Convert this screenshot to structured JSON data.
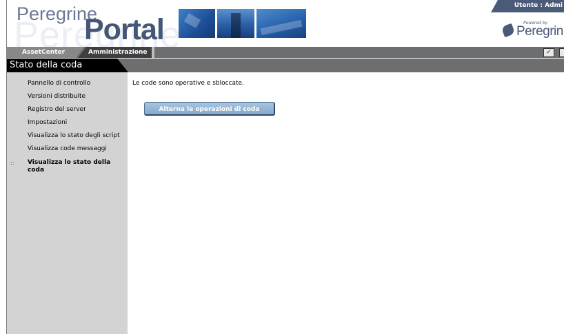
{
  "header": {
    "brand_small": "Peregrine",
    "brand_big": "Portal",
    "brand_ghost": "Peregrine",
    "user_label": "Utente : Admi",
    "powered_by": "Powered by",
    "powered_brand": "Peregrin"
  },
  "tabs": [
    {
      "label": "AssetCenter"
    },
    {
      "label": "Amministrazione"
    }
  ],
  "toolbar": {
    "icons": [
      "check-icon",
      "document-icon"
    ]
  },
  "page": {
    "title": "Stato della coda"
  },
  "sidebar": {
    "items": [
      {
        "label": "Pannello di controllo"
      },
      {
        "label": "Versioni distribuite"
      },
      {
        "label": "Registro del server"
      },
      {
        "label": "Impostazioni"
      },
      {
        "label": "Visualizza lo stato degli script"
      },
      {
        "label": "Visualizza code messaggi"
      },
      {
        "label": "Visualizza lo stato della coda",
        "active": true
      }
    ],
    "active_marker": "::"
  },
  "main": {
    "status_message": "Le code sono operative e sbloccate.",
    "toggle_button_label": "Alterna le operazioni di coda"
  },
  "colors": {
    "header_bar": "#6d6e70",
    "title_tab": "#000000",
    "sidebar_bg": "#d3d3d3",
    "button_bg": "#94b3d3",
    "brand_text": "#445777"
  }
}
